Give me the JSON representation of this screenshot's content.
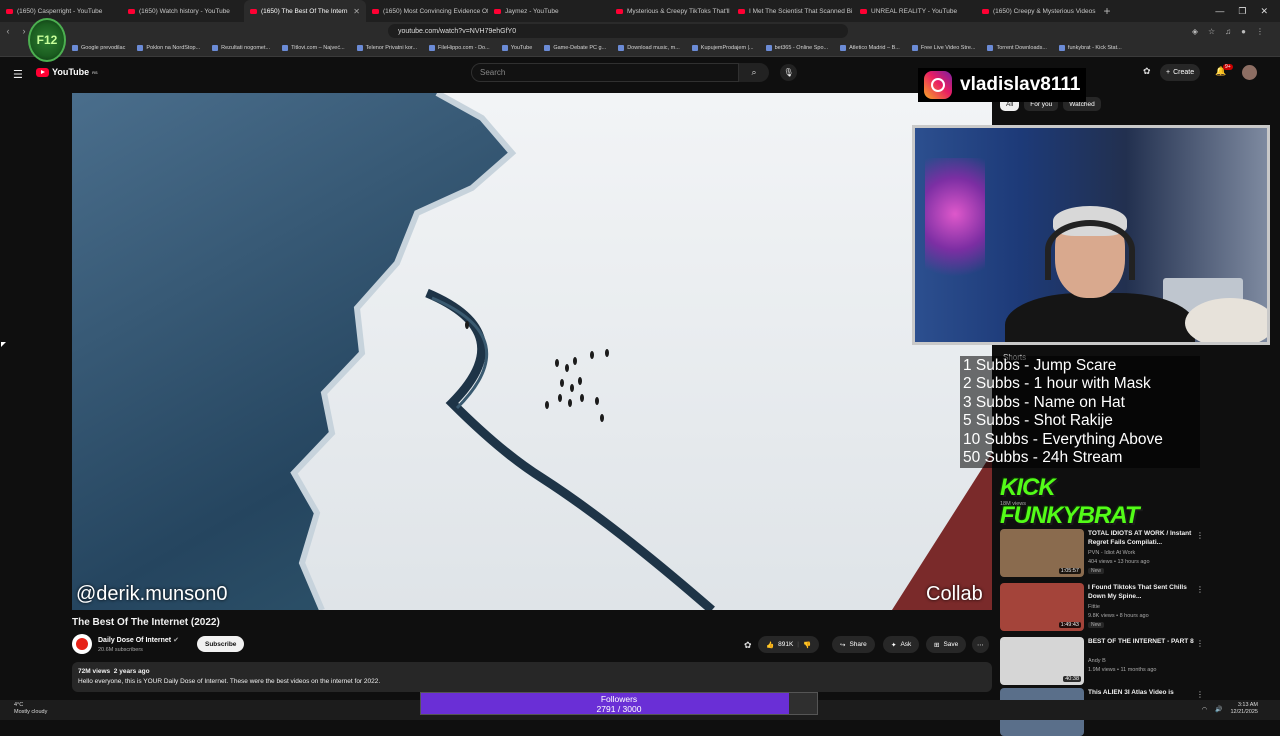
{
  "browser": {
    "tabs": [
      {
        "label": "(1650) Casperright - YouTube",
        "active": false
      },
      {
        "label": "(1650) Watch history - YouTube",
        "active": false
      },
      {
        "label": "(1650) The Best Of The Intern",
        "active": true
      },
      {
        "label": "(1650) Most Convincing Evidence Of",
        "active": false
      },
      {
        "label": "Jaymez - YouTube",
        "active": false
      },
      {
        "label": "Mysterious & Creepy TikToks That'll",
        "active": false
      },
      {
        "label": "I Met The Scientist That Scanned Bi",
        "active": false
      },
      {
        "label": "UNREAL REALITY - YouTube",
        "active": false
      },
      {
        "label": "(1650) Creepy & Mysterious Videos",
        "active": false
      }
    ],
    "url": "youtube.com/watch?v=NVH79ehGfY0",
    "bookmarks": [
      "Google prevodilac",
      "Poklon na NordStop...",
      "Rezultati nogomet...",
      "Titlovi.com – Najveć...",
      "Telenor Privatni kor...",
      "FileHippo.com - Do...",
      "YouTube",
      "Game-Debate PC g...",
      "Download music, m...",
      "KupujemProdajem |...",
      "bet365 - Online Spo...",
      "Atletico Madrid – B...",
      "Free Live Video Stre...",
      "Torrent Downloads...",
      "funkybrat - Kick Stat..."
    ]
  },
  "youtube": {
    "logo": "YouTube",
    "region": "RS",
    "search_placeholder": "Search",
    "create_label": "Create",
    "notifications": "9+",
    "chips": [
      "All",
      "For you",
      "Watched"
    ]
  },
  "video": {
    "overlay_handle": "@derik.munson0",
    "overlay_tag": "Collab",
    "title": "The Best Of The Internet (2022)",
    "channel": "Daily Dose Of Internet",
    "subscribers": "20.6M subscribers",
    "subscribe_label": "Subscribe",
    "likes": "891K",
    "share_label": "Share",
    "ask_label": "Ask",
    "save_label": "Save",
    "views": "72M views",
    "age": "2 years ago",
    "description": "Hello everyone, this is YOUR Daily Dose of Internet. These were the best videos on the internet for 2022."
  },
  "stream_overlay": {
    "instagram_handle": "vladislav8111",
    "sub_goals": [
      "1 Subbs - Jump Scare",
      "2 Subbs - 1 hour with Mask",
      "3 Subbs - Name on Hat",
      "5 Subbs - Shot Rakije",
      "10 Subbs - Everything Above",
      "50 Subbs - 24h Stream"
    ],
    "kick_brand": "KICK FUNKYBRAT",
    "followers_label": "Followers",
    "followers_count": "2791 / 3000",
    "followers_fraction": 0.93
  },
  "sidebar": {
    "shorts_label": "Shorts",
    "kick_meta": "18M views",
    "items": [
      {
        "title": "TOTAL IDIOTS AT WORK / Instant Regret Fails Compilati...",
        "channel": "PVN - Idiot At Work",
        "meta": "404 views • 13 hours ago",
        "badge": "New",
        "duration": "1:05:57",
        "color": "#8a6b4e"
      },
      {
        "title": "I Found Tiktoks That Sent Chills Down My Spine...",
        "channel": "Fittie",
        "meta": "9.8K views • 8 hours ago",
        "badge": "New",
        "duration": "1:49:43",
        "color": "#a4443a"
      },
      {
        "title": "BEST OF THE INTERNET - PART 8",
        "channel": "Andy B",
        "meta": "1.9M views • 11 months ago",
        "badge": "",
        "duration": "40:38",
        "color": "#d6d6d6"
      },
      {
        "title": "This ALIEN 3I Atlas Video is",
        "channel": "",
        "meta": "",
        "badge": "",
        "duration": "",
        "color": "#5a6f8a"
      }
    ]
  },
  "taskbar": {
    "temperature": "4°C",
    "weather": "Mostly cloudy",
    "time": "3:13 AM",
    "date": "12/21/2025"
  },
  "colors": {
    "accent_red": "#ff0033",
    "kick_green": "#53fc18",
    "followers_purple": "#6a2fd6",
    "background": "#0f0f0f"
  }
}
